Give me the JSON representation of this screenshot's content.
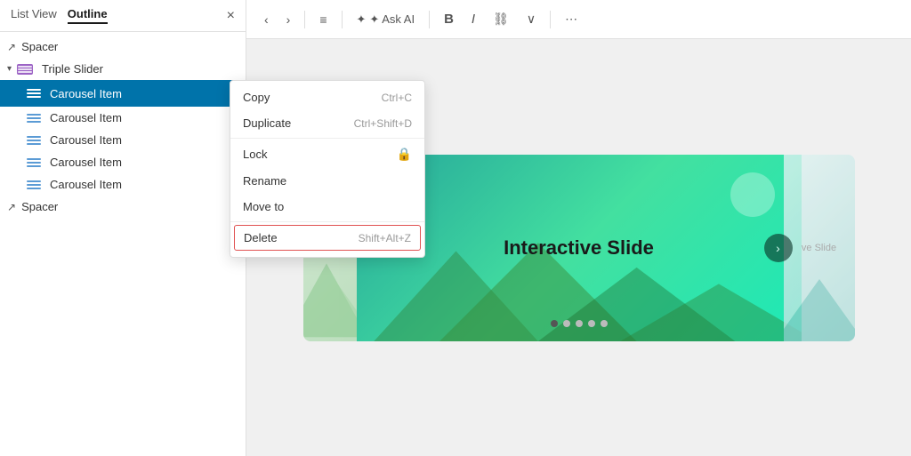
{
  "panel": {
    "tabs": [
      {
        "label": "List View",
        "active": false
      },
      {
        "label": "Outline",
        "active": true
      }
    ],
    "close_label": "×",
    "tree_items": [
      {
        "id": "spacer1",
        "label": "Spacer",
        "type": "spacer",
        "indent": 0,
        "expanded": null
      },
      {
        "id": "triple-slider",
        "label": "Triple Slider",
        "type": "slider",
        "indent": 0,
        "expanded": true
      },
      {
        "id": "carousel-1",
        "label": "Carousel Item",
        "type": "carousel",
        "indent": 1,
        "selected": true
      },
      {
        "id": "carousel-2",
        "label": "Carousel Item",
        "type": "carousel",
        "indent": 1,
        "selected": false
      },
      {
        "id": "carousel-3",
        "label": "Carousel Item",
        "type": "carousel",
        "indent": 1,
        "selected": false
      },
      {
        "id": "carousel-4",
        "label": "Carousel Item",
        "type": "carousel",
        "indent": 1,
        "selected": false
      },
      {
        "id": "carousel-5",
        "label": "Carousel Item",
        "type": "carousel",
        "indent": 1,
        "selected": false
      },
      {
        "id": "spacer2",
        "label": "Spacer",
        "type": "spacer",
        "indent": 0,
        "expanded": null
      }
    ]
  },
  "context_menu": {
    "items": [
      {
        "label": "Copy",
        "shortcut": "Ctrl+C",
        "type": "action"
      },
      {
        "label": "Duplicate",
        "shortcut": "Ctrl+Shift+D",
        "type": "action"
      },
      {
        "label": "Lock",
        "shortcut": "",
        "type": "action",
        "has_icon": true
      },
      {
        "label": "Rename",
        "shortcut": "",
        "type": "action"
      },
      {
        "label": "Move to",
        "shortcut": "",
        "type": "action"
      },
      {
        "label": "Delete",
        "shortcut": "Shift+Alt+Z",
        "type": "delete"
      }
    ]
  },
  "toolbar": {
    "back_label": "‹",
    "forward_label": "›",
    "align_label": "≡",
    "ask_ai_label": "✦ Ask AI",
    "bold_label": "B",
    "italic_label": "I",
    "link_label": "🔗",
    "chevron_label": "∨",
    "more_label": "⋯"
  },
  "slide": {
    "title": "Interactive Slide",
    "right_text": "ve Slide",
    "dots_count": 5,
    "active_dot": 0
  },
  "colors": {
    "selected_bg": "#0073aa",
    "delete_border": "#e05252",
    "slide_main_start": "#26a69a",
    "slide_main_end": "#43e097"
  }
}
